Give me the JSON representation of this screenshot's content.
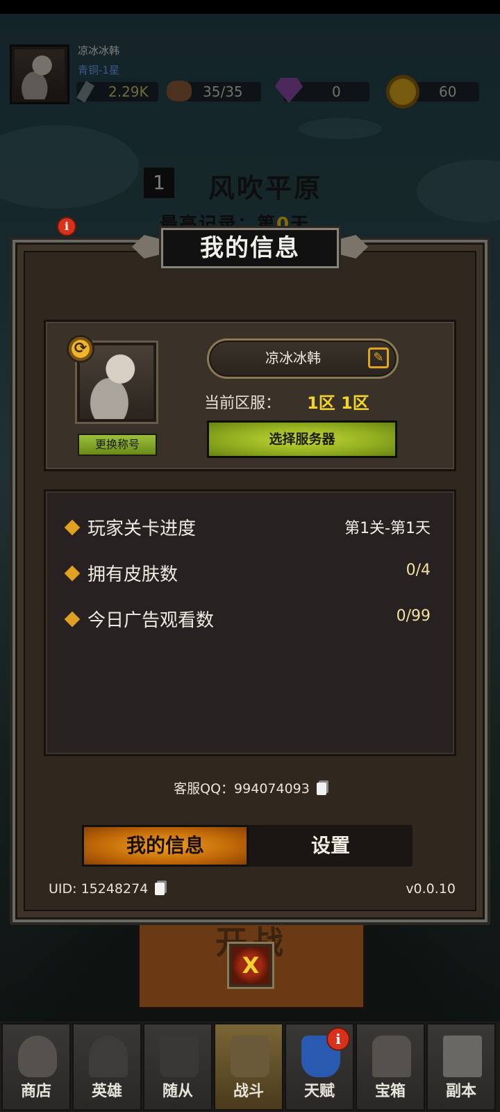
{
  "hud": {
    "player_name": "凉冰冰韩",
    "rank": "青铜-1星",
    "power": "2.29K",
    "stamina": "35/35",
    "gems": "0",
    "coins": "60",
    "icons": {
      "power": "sword-icon",
      "stamina": "meat-icon",
      "gems": "gem-icon",
      "coins": "coin-icon"
    }
  },
  "stage": {
    "number": "1",
    "name": "风吹平原",
    "record_prefix": "最高记录：第",
    "record_day": "0",
    "record_suffix": "天"
  },
  "dialog": {
    "title": "我的信息",
    "change_title_label": "更换称号",
    "nickname": "凉冰冰韩",
    "server_label": "当前区服：",
    "server_value": "1区 1区",
    "select_server_label": "选择服务器",
    "stats": [
      {
        "label": "玩家关卡进度",
        "value": "第1关-第1天"
      },
      {
        "label": "拥有皮肤数",
        "value": "0/4"
      },
      {
        "label": "今日广告观看数",
        "value": "0/99"
      }
    ],
    "support_qq": "客服QQ：994074093",
    "tabs": [
      {
        "label": "我的信息",
        "active": true
      },
      {
        "label": "设置",
        "active": false
      }
    ],
    "uid": "UID: 15248274",
    "version": "v0.0.10",
    "close_label": "X"
  },
  "fight_button": {
    "label": "开战"
  },
  "nav": [
    {
      "label": "商店",
      "icon": "shop-bag-icon",
      "active": false,
      "badge": ""
    },
    {
      "label": "英雄",
      "icon": "helmet-icon",
      "active": false,
      "badge": ""
    },
    {
      "label": "随从",
      "icon": "warrior-icon",
      "active": false,
      "badge": ""
    },
    {
      "label": "战斗",
      "icon": "crossed-swords-icon",
      "active": true,
      "badge": ""
    },
    {
      "label": "天赋",
      "icon": "shield-arrow-icon",
      "active": false,
      "badge": "i"
    },
    {
      "label": "宝箱",
      "icon": "chest-icon",
      "active": false,
      "badge": ""
    },
    {
      "label": "副本",
      "icon": "scroll-icon",
      "active": false,
      "badge": ""
    }
  ],
  "colors": {
    "accent_gold": "#f2d52c",
    "button_green": "#94b020",
    "tab_orange": "#e08a14",
    "rank_blue": "#6fa2ff"
  }
}
